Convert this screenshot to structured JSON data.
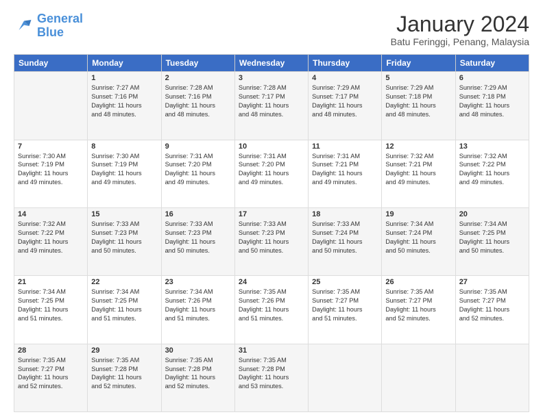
{
  "header": {
    "logo_line1": "General",
    "logo_line2": "Blue",
    "month": "January 2024",
    "location": "Batu Feringgi, Penang, Malaysia"
  },
  "columns": [
    "Sunday",
    "Monday",
    "Tuesday",
    "Wednesday",
    "Thursday",
    "Friday",
    "Saturday"
  ],
  "rows": [
    [
      {
        "day": "",
        "text": ""
      },
      {
        "day": "1",
        "text": "Sunrise: 7:27 AM\nSunset: 7:16 PM\nDaylight: 11 hours\nand 48 minutes."
      },
      {
        "day": "2",
        "text": "Sunrise: 7:28 AM\nSunset: 7:16 PM\nDaylight: 11 hours\nand 48 minutes."
      },
      {
        "day": "3",
        "text": "Sunrise: 7:28 AM\nSunset: 7:17 PM\nDaylight: 11 hours\nand 48 minutes."
      },
      {
        "day": "4",
        "text": "Sunrise: 7:29 AM\nSunset: 7:17 PM\nDaylight: 11 hours\nand 48 minutes."
      },
      {
        "day": "5",
        "text": "Sunrise: 7:29 AM\nSunset: 7:18 PM\nDaylight: 11 hours\nand 48 minutes."
      },
      {
        "day": "6",
        "text": "Sunrise: 7:29 AM\nSunset: 7:18 PM\nDaylight: 11 hours\nand 48 minutes."
      }
    ],
    [
      {
        "day": "7",
        "text": "Sunrise: 7:30 AM\nSunset: 7:19 PM\nDaylight: 11 hours\nand 49 minutes."
      },
      {
        "day": "8",
        "text": "Sunrise: 7:30 AM\nSunset: 7:19 PM\nDaylight: 11 hours\nand 49 minutes."
      },
      {
        "day": "9",
        "text": "Sunrise: 7:31 AM\nSunset: 7:20 PM\nDaylight: 11 hours\nand 49 minutes."
      },
      {
        "day": "10",
        "text": "Sunrise: 7:31 AM\nSunset: 7:20 PM\nDaylight: 11 hours\nand 49 minutes."
      },
      {
        "day": "11",
        "text": "Sunrise: 7:31 AM\nSunset: 7:21 PM\nDaylight: 11 hours\nand 49 minutes."
      },
      {
        "day": "12",
        "text": "Sunrise: 7:32 AM\nSunset: 7:21 PM\nDaylight: 11 hours\nand 49 minutes."
      },
      {
        "day": "13",
        "text": "Sunrise: 7:32 AM\nSunset: 7:22 PM\nDaylight: 11 hours\nand 49 minutes."
      }
    ],
    [
      {
        "day": "14",
        "text": "Sunrise: 7:32 AM\nSunset: 7:22 PM\nDaylight: 11 hours\nand 49 minutes."
      },
      {
        "day": "15",
        "text": "Sunrise: 7:33 AM\nSunset: 7:23 PM\nDaylight: 11 hours\nand 50 minutes."
      },
      {
        "day": "16",
        "text": "Sunrise: 7:33 AM\nSunset: 7:23 PM\nDaylight: 11 hours\nand 50 minutes."
      },
      {
        "day": "17",
        "text": "Sunrise: 7:33 AM\nSunset: 7:23 PM\nDaylight: 11 hours\nand 50 minutes."
      },
      {
        "day": "18",
        "text": "Sunrise: 7:33 AM\nSunset: 7:24 PM\nDaylight: 11 hours\nand 50 minutes."
      },
      {
        "day": "19",
        "text": "Sunrise: 7:34 AM\nSunset: 7:24 PM\nDaylight: 11 hours\nand 50 minutes."
      },
      {
        "day": "20",
        "text": "Sunrise: 7:34 AM\nSunset: 7:25 PM\nDaylight: 11 hours\nand 50 minutes."
      }
    ],
    [
      {
        "day": "21",
        "text": "Sunrise: 7:34 AM\nSunset: 7:25 PM\nDaylight: 11 hours\nand 51 minutes."
      },
      {
        "day": "22",
        "text": "Sunrise: 7:34 AM\nSunset: 7:25 PM\nDaylight: 11 hours\nand 51 minutes."
      },
      {
        "day": "23",
        "text": "Sunrise: 7:34 AM\nSunset: 7:26 PM\nDaylight: 11 hours\nand 51 minutes."
      },
      {
        "day": "24",
        "text": "Sunrise: 7:35 AM\nSunset: 7:26 PM\nDaylight: 11 hours\nand 51 minutes."
      },
      {
        "day": "25",
        "text": "Sunrise: 7:35 AM\nSunset: 7:27 PM\nDaylight: 11 hours\nand 51 minutes."
      },
      {
        "day": "26",
        "text": "Sunrise: 7:35 AM\nSunset: 7:27 PM\nDaylight: 11 hours\nand 52 minutes."
      },
      {
        "day": "27",
        "text": "Sunrise: 7:35 AM\nSunset: 7:27 PM\nDaylight: 11 hours\nand 52 minutes."
      }
    ],
    [
      {
        "day": "28",
        "text": "Sunrise: 7:35 AM\nSunset: 7:27 PM\nDaylight: 11 hours\nand 52 minutes."
      },
      {
        "day": "29",
        "text": "Sunrise: 7:35 AM\nSunset: 7:28 PM\nDaylight: 11 hours\nand 52 minutes."
      },
      {
        "day": "30",
        "text": "Sunrise: 7:35 AM\nSunset: 7:28 PM\nDaylight: 11 hours\nand 52 minutes."
      },
      {
        "day": "31",
        "text": "Sunrise: 7:35 AM\nSunset: 7:28 PM\nDaylight: 11 hours\nand 53 minutes."
      },
      {
        "day": "",
        "text": ""
      },
      {
        "day": "",
        "text": ""
      },
      {
        "day": "",
        "text": ""
      }
    ]
  ]
}
